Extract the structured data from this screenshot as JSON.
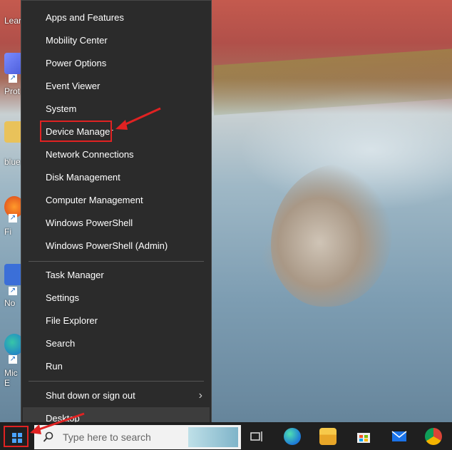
{
  "desktop": {
    "icons": [
      {
        "label": "Lear\nthis",
        "icon": "learn-icon"
      },
      {
        "label": "Prot",
        "icon": "protect-icon"
      },
      {
        "label": "blue",
        "icon": "folder-icon"
      },
      {
        "label": "Fi",
        "icon": "firefox-icon"
      },
      {
        "label": "No",
        "icon": "app-icon"
      },
      {
        "label": "Mic\nE",
        "icon": "edge-icon"
      }
    ]
  },
  "menu": {
    "group1": [
      "Apps and Features",
      "Mobility Center",
      "Power Options",
      "Event Viewer",
      "System",
      "Device Manager",
      "Network Connections",
      "Disk Management",
      "Computer Management",
      "Windows PowerShell",
      "Windows PowerShell (Admin)"
    ],
    "group2": [
      "Task Manager",
      "Settings",
      "File Explorer",
      "Search",
      "Run"
    ],
    "group3": [
      "Shut down or sign out",
      "Desktop"
    ],
    "chevron": "›"
  },
  "taskbar": {
    "search_placeholder": "Type here to search",
    "search_icon": "search-icon",
    "apps": [
      "task-view-icon",
      "edge-icon",
      "file-explorer-icon",
      "store-icon",
      "mail-icon",
      "chrome-icon"
    ]
  },
  "colors": {
    "menu_bg": "#2b2b2b",
    "annotation_red": "#e02222",
    "taskbar_bg": "#1f1f1f"
  }
}
